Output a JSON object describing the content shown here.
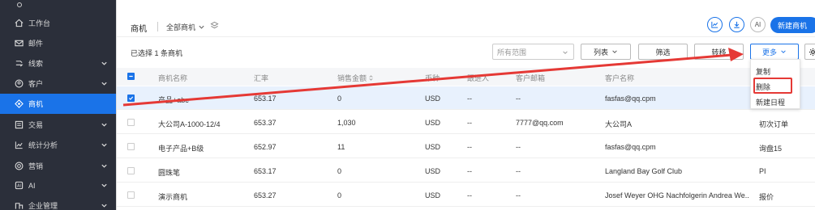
{
  "sidebar": {
    "items": [
      {
        "label": "工作台",
        "icon": "home-icon",
        "active": false,
        "chevron": false
      },
      {
        "label": "邮件",
        "icon": "mail-icon",
        "active": false,
        "chevron": false
      },
      {
        "label": "线索",
        "icon": "leads-icon",
        "active": false,
        "chevron": true
      },
      {
        "label": "客户",
        "icon": "customer-icon",
        "active": false,
        "chevron": true
      },
      {
        "label": "商机",
        "icon": "opportunity-icon",
        "active": true,
        "chevron": false
      },
      {
        "label": "交易",
        "icon": "trade-icon",
        "active": false,
        "chevron": true
      },
      {
        "label": "统计分析",
        "icon": "chart-icon",
        "active": false,
        "chevron": true
      },
      {
        "label": "营销",
        "icon": "marketing-icon",
        "active": false,
        "chevron": true
      },
      {
        "label": "AI",
        "icon": "ai-icon",
        "active": false,
        "chevron": true
      },
      {
        "label": "企业管理",
        "icon": "enterprise-icon",
        "active": false,
        "chevron": true
      }
    ]
  },
  "header": {
    "title": "商机",
    "scope": "全部商机",
    "ai_label": "AI",
    "new_button": "新建商机"
  },
  "toolbar": {
    "selected_info": "已选择 1 条商机",
    "range_placeholder": "所有范围",
    "list_label": "列表",
    "filter_label": "筛选",
    "transfer_label": "转移",
    "more_label": "更多"
  },
  "menu": {
    "items": [
      "复制",
      "删除",
      "新建日程"
    ],
    "highlighted": "删除"
  },
  "table": {
    "headers": [
      "商机名称",
      "汇率",
      "销售金额",
      "币种",
      "跟进人",
      "客户邮箱",
      "客户名称",
      ""
    ],
    "rows": [
      {
        "name": "产品+abc",
        "rate": "653.17",
        "amount": "0",
        "currency": "USD",
        "follower": "--",
        "email": "--",
        "customer": "fasfas@qq.cpm",
        "stage": "",
        "selected": true
      },
      {
        "name": "大公司A-1000-12/4",
        "rate": "653.37",
        "amount": "1,030",
        "currency": "USD",
        "follower": "--",
        "email": "7777@qq.com",
        "customer": "大公司A",
        "stage": "初次订单",
        "selected": false
      },
      {
        "name": "电子产品+B级",
        "rate": "652.97",
        "amount": "11",
        "currency": "USD",
        "follower": "--",
        "email": "--",
        "customer": "fasfas@qq.cpm",
        "stage": "询盘15",
        "selected": false
      },
      {
        "name": "圆珠笔",
        "rate": "653.17",
        "amount": "0",
        "currency": "USD",
        "follower": "--",
        "email": "--",
        "customer": "Langland Bay Golf Club",
        "stage": "PI",
        "selected": false
      },
      {
        "name": "演示商机",
        "rate": "653.27",
        "amount": "0",
        "currency": "USD",
        "follower": "--",
        "email": "--",
        "customer": "Josef Weyer OHG Nachfolgerin Andrea We...",
        "stage": "报价",
        "selected": false
      }
    ]
  },
  "colors": {
    "sidebar_bg": "#2b2f3a",
    "accent": "#1a73e8",
    "annotation_red": "#e53935"
  }
}
